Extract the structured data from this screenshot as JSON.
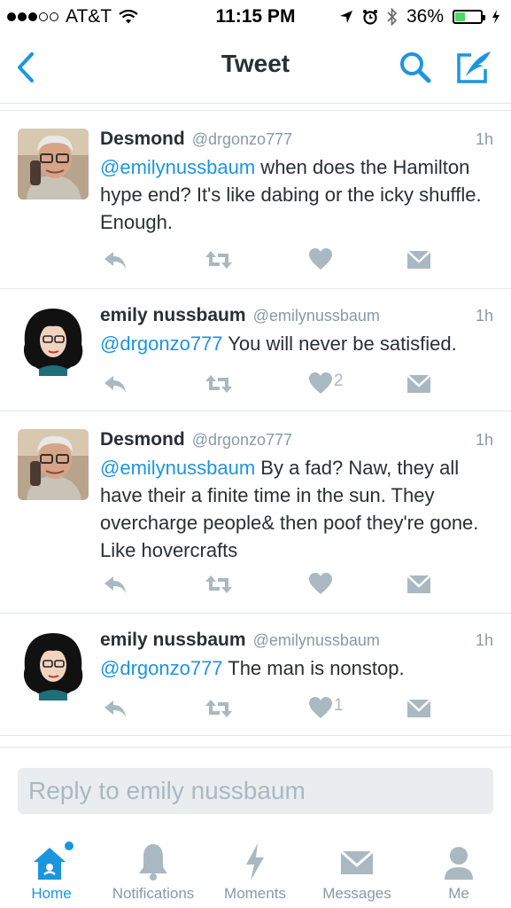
{
  "status_bar": {
    "carrier": "AT&T",
    "time": "11:15 PM",
    "battery": "36%"
  },
  "nav": {
    "title": "Tweet"
  },
  "tweets": [
    {
      "name": "Desmond",
      "handle": "@drgonzo777",
      "time": "1h",
      "mention": "@emilynussbaum",
      "text": " when does the Hamilton hype end? It's like dabing or the icky shuffle. Enough.",
      "likes": ""
    },
    {
      "name": "emily nussbaum",
      "handle": "@emilynussbaum",
      "time": "1h",
      "mention": "@drgonzo777",
      "text": " You will never be satisfied.",
      "likes": "2"
    },
    {
      "name": "Desmond",
      "handle": "@drgonzo777",
      "time": "1h",
      "mention": "@emilynussbaum",
      "text": " By a fad? Naw, they all have their a finite time in the sun. They overcharge people& then poof they're gone. Like hovercrafts",
      "likes": ""
    },
    {
      "name": "emily nussbaum",
      "handle": "@emilynussbaum",
      "time": "1h",
      "mention": "@drgonzo777",
      "text": " The man is nonstop.",
      "likes": "1"
    }
  ],
  "reply": {
    "placeholder": "Reply to emily nussbaum"
  },
  "tabs": [
    {
      "label": "Home",
      "icon": "home-icon"
    },
    {
      "label": "Notifications",
      "icon": "bell-icon"
    },
    {
      "label": "Moments",
      "icon": "lightning-icon"
    },
    {
      "label": "Messages",
      "icon": "envelope-icon"
    },
    {
      "label": "Me",
      "icon": "person-icon"
    }
  ],
  "colors": {
    "accent": "#1b95e0",
    "text": "#292f33",
    "muted": "#8899a6",
    "icon": "#aab8c2",
    "battery": "#4cd964"
  }
}
